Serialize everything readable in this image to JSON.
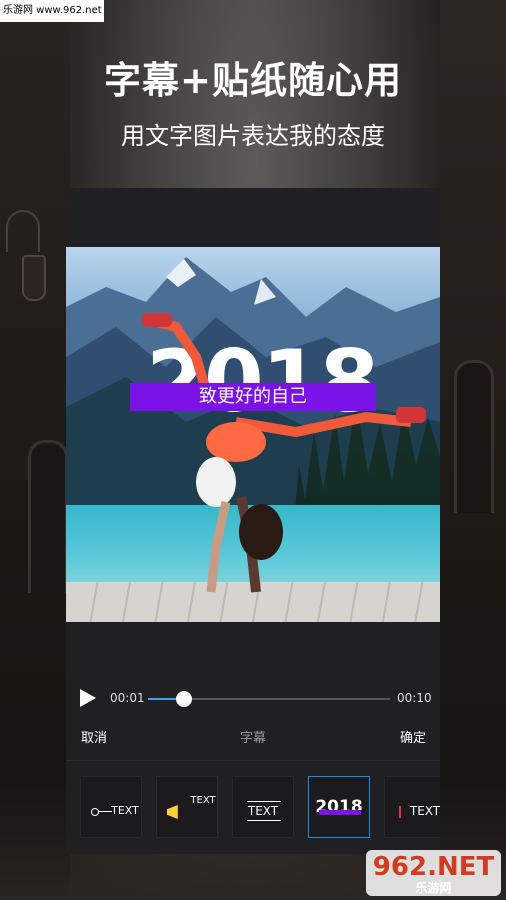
{
  "watermark_top": "乐游网 www.962.net",
  "headline": "字幕+贴纸随心用",
  "subline": "用文字图片表达我的态度",
  "photo": {
    "year_text": "2018",
    "caption_text": "致更好的自己"
  },
  "player": {
    "current_time": "00:01",
    "total_time": "00:10",
    "progress": 0.15,
    "accent_color": "#3ea2e8"
  },
  "actions": {
    "cancel": "取消",
    "title": "字幕",
    "confirm": "确定"
  },
  "stickers": [
    {
      "label": "TEXT",
      "icon": "line-text-icon"
    },
    {
      "label": "TEXT",
      "icon": "megaphone-icon"
    },
    {
      "label": "TEXT",
      "icon": "underline-text-icon"
    },
    {
      "label": "2018",
      "icon": "year-banner-icon",
      "selected": true
    },
    {
      "label": "TEXT",
      "icon": "bar-text-icon"
    }
  ],
  "watermark_bottom": {
    "logo": "962.NET",
    "name": "乐游网"
  }
}
